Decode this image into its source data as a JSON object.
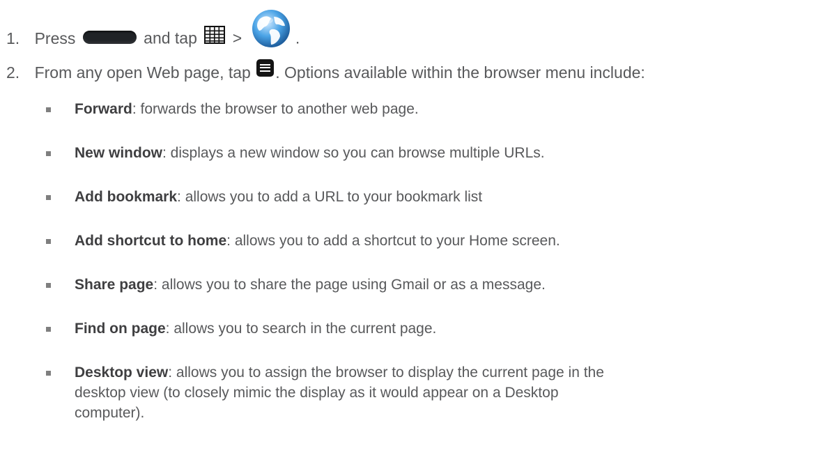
{
  "steps": [
    {
      "number": "1.",
      "text_a": "Press",
      "text_b": "and tap",
      "text_c": ">",
      "text_d": ".",
      "icons": [
        "home-key-icon",
        "apps-grid-icon",
        "browser-globe-icon"
      ]
    },
    {
      "number": "2.",
      "text_a": "From any open Web page, tap",
      "text_b": ". Options available within the browser menu include:",
      "icons": [
        "menu-key-icon"
      ]
    }
  ],
  "options": [
    {
      "term": "Forward",
      "desc": ": forwards the browser to another web page."
    },
    {
      "term": "New window",
      "desc": ": displays a new window so you can browse multiple URLs."
    },
    {
      "term": "Add bookmark",
      "desc": ": allows you to add a URL to your bookmark list"
    },
    {
      "term": "Add shortcut to home",
      "desc": ": allows you to add a shortcut to your Home screen."
    },
    {
      "term": "Share page",
      "desc": ": allows you to share the page using Gmail or as a message."
    },
    {
      "term": "Find on page",
      "desc": ": allows you to search in the current page."
    },
    {
      "term": "Desktop view",
      "desc": ": allows you to assign the browser to display the current page in the",
      "desc_line2": "desktop view (to closely mimic the display as it would appear on a Desktop",
      "desc_line3": "computer)."
    }
  ]
}
